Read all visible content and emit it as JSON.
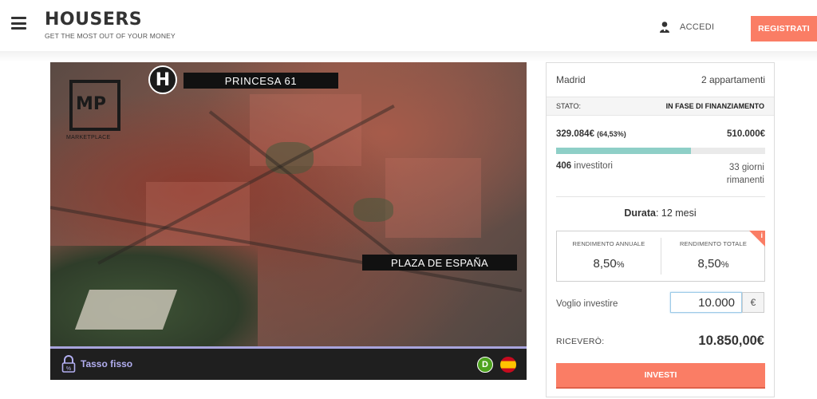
{
  "header": {
    "logo_word": "HOUSERS",
    "logo_tagline": "GET THE MOST OUT OF YOUR MONEY",
    "login_label": "ACCEDI",
    "register_label": "REGISTRATI"
  },
  "property": {
    "mp_text": "MP",
    "mp_subtitle": "MARKETPLACE",
    "h_logo": "H",
    "label_top": "PRINCESA 61",
    "label_bottom": "PLAZA DE ESPAÑA",
    "rate_type": "Tasso fisso",
    "rate_icon_text": "%",
    "rating_badge": "D"
  },
  "card": {
    "city": "Madrid",
    "type": "2 appartamenti",
    "state_label": "STATO:",
    "state_value": "IN FASE DI FINANZIAMENTO",
    "raised": "329.084€",
    "raised_pct": "(64,53%)",
    "progress_fraction": 0.6453,
    "target": "510.000€",
    "investors_count": "406",
    "investors_label": "investitori",
    "days_left": "33 giorni rimanenti",
    "duration_label": "Durata",
    "duration_value": ": 12 mesi",
    "annual_return_label": "RENDIMENTO ANNUALE",
    "annual_return_value": "8,50",
    "total_return_label": "RENDIMENTO TOTALE",
    "total_return_value": "8,50",
    "percent_unit": "%",
    "info_badge": "i",
    "invest_label": "Voglio investire",
    "invest_amount": "10.000",
    "currency": "€",
    "receive_label": "RICEVERÒ:",
    "receive_value": "10.850,00€",
    "invest_button": "INVESTI"
  },
  "colors": {
    "accent": "#fa7d65",
    "progress": "#8ecfc7",
    "rate_text": "#b2aef0"
  },
  "icons": [
    "hamburger-menu-icon",
    "user-icon",
    "lock-icon",
    "spain-flag-icon"
  ]
}
